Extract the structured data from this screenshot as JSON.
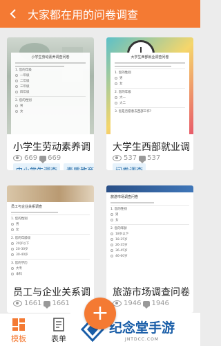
{
  "header": {
    "back_icon": "arrow-left-icon",
    "title": "大家都在用的问卷调查"
  },
  "colors": {
    "brand": "#f47a33",
    "tag_bg": "#e6f2fb",
    "tag_text": "#2a6fa8"
  },
  "cards": [
    {
      "title": "小学生劳动素养调...",
      "views": "669",
      "uses": "669",
      "tags": [
        "中小学生调查",
        "素质教育"
      ],
      "doc": {
        "title": "小学生劳动素养调查问卷",
        "questions": [
          {
            "q": "1. 您的年级",
            "options": [
              "一年级",
              "二年级",
              "三年级",
              "四年级"
            ]
          },
          {
            "q": "2. 您的性别",
            "options": [
              "男",
              "女"
            ]
          }
        ]
      }
    },
    {
      "title": "大学生西部就业调...",
      "views": "537",
      "uses": "537",
      "tags": [
        "问卷调查"
      ],
      "doc": {
        "title": "大学生西部就业调查问卷",
        "questions": [
          {
            "q": "1. 您的性别",
            "options": [
              "男",
              "女"
            ]
          },
          {
            "q": "2. 您的年级",
            "options": [
              "大一",
              "大二"
            ]
          },
          {
            "q": "3. 您是否愿意去西部工作?",
            "options": []
          }
        ]
      }
    },
    {
      "title": "员工与企业关系调查",
      "views": "1661",
      "uses": "1661",
      "tags": [],
      "doc": {
        "title": "员工与企业关系调查",
        "questions": [
          {
            "q": "1. 您的性别",
            "options": [
              "男",
              "女"
            ]
          },
          {
            "q": "2. 您的年龄段",
            "options": [
              "20岁以下",
              "20-30岁",
              "30-40岁"
            ]
          },
          {
            "q": "3. 您的学历",
            "options": [
              "大专",
              "本科"
            ]
          }
        ]
      }
    },
    {
      "title": "旅游市场调查问卷",
      "views": "1946",
      "uses": "1946",
      "tags": [],
      "doc": {
        "title": "旅游市场调查问卷",
        "questions": [
          {
            "q": "1. 您的性别",
            "options": [
              "男",
              "女"
            ]
          },
          {
            "q": "2. 您的年龄",
            "options": [
              "18岁以下",
              "18-25岁",
              "26-35岁",
              "36-45岁",
              "46-60岁"
            ]
          }
        ]
      }
    }
  ],
  "tabbar": {
    "tabs": [
      {
        "label": "模板",
        "icon": "template-grid-icon",
        "active": true
      },
      {
        "label": "表单",
        "icon": "form-icon",
        "active": false
      }
    ],
    "fab_icon": "plus-icon",
    "fab_label": "+"
  },
  "watermark": {
    "name": "纪念堂手游",
    "url": "JNTDCC.COM"
  }
}
